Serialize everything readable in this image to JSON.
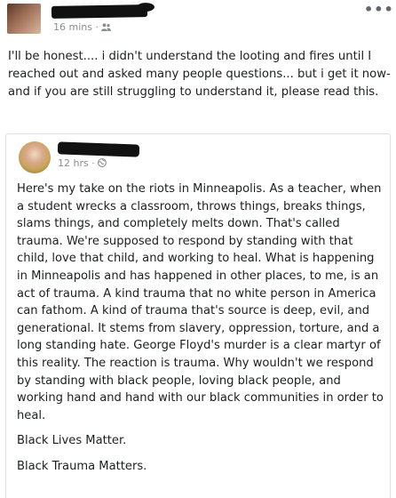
{
  "outer_post": {
    "timestamp": "16 mins",
    "audience_icon": "friends-icon",
    "more_icon": "more-options-icon",
    "text": "I'll be honest.... i didn't understand the looting and fires until I reached out and asked many people questions... but i get it now- and if you are still struggling to understand it, please read this."
  },
  "shared_post": {
    "timestamp": "12 hrs",
    "audience_icon": "globe-icon",
    "paragraphs": [
      "Here's my take on the riots in Minneapolis. As a teacher, when a student wrecks a classroom, throws things, breaks things, slams things, and completely melts down. That's called trauma. We're supposed to respond by standing with that child, love that child, and working to heal. What is happening in Minneapolis and has happened in other places, to me, is an act of trauma. A kind trauma that no white person in America can fathom. A kind of trauma that's source is deep, evil, and generational. It stems from slavery, oppression, torture, and a long standing hate. George Floyd's murder is a clear martyr of this reality. The reaction is trauma. Why wouldn't we respond by standing with black people, loving black people, and working hand and hand with our black communities in order to heal.",
      "Black Lives Matter.",
      "Black Trauma Matters."
    ]
  }
}
